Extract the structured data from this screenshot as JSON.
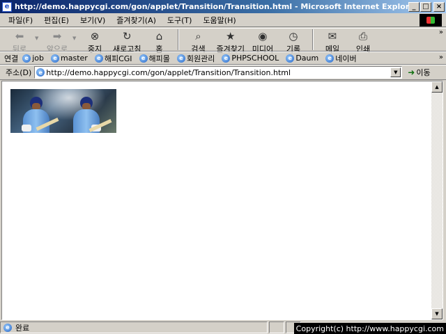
{
  "window": {
    "title": "http://demo.happycgi.com/gon/applet/Transition/Transition.html - Microsoft Internet Explorer"
  },
  "menu": [
    {
      "label": "파일(F)"
    },
    {
      "label": "편집(E)"
    },
    {
      "label": "보기(V)"
    },
    {
      "label": "즐겨찾기(A)"
    },
    {
      "label": "도구(T)"
    },
    {
      "label": "도움말(H)"
    }
  ],
  "toolbar": {
    "back": {
      "label": "뒤로",
      "icon": "back-arrow-icon"
    },
    "forward": {
      "label": "앞으로",
      "icon": "forward-arrow-icon"
    },
    "stop": {
      "label": "중지",
      "icon": "stop-icon"
    },
    "refresh": {
      "label": "새로고침",
      "icon": "refresh-icon"
    },
    "home": {
      "label": "홈",
      "icon": "home-icon"
    },
    "search": {
      "label": "검색",
      "icon": "search-icon"
    },
    "favorites": {
      "label": "즐겨찾기",
      "icon": "favorites-icon"
    },
    "media": {
      "label": "미디어",
      "icon": "media-icon"
    },
    "history": {
      "label": "기록",
      "icon": "history-icon"
    },
    "mail": {
      "label": "메일",
      "icon": "mail-icon"
    },
    "print": {
      "label": "인쇄",
      "icon": "print-icon"
    }
  },
  "links": {
    "label": "연결",
    "items": [
      {
        "label": "job"
      },
      {
        "label": "master"
      },
      {
        "label": "해피CGI"
      },
      {
        "label": "해피몰"
      },
      {
        "label": "회원관리"
      },
      {
        "label": "PHPSCHOOL"
      },
      {
        "label": "Daum"
      },
      {
        "label": "네이버"
      }
    ]
  },
  "address": {
    "label": "주소(D)",
    "value": "http://demo.happycgi.com/gon/applet/Transition/Transition.html",
    "go_label": "이동"
  },
  "status": {
    "text": "완료",
    "copyright": "Copyright(c) http://www.happycgi.com"
  },
  "colors": {
    "titlebar_start": "#0a246a",
    "titlebar_end": "#a6caf0",
    "chrome": "#d4d0c8"
  }
}
